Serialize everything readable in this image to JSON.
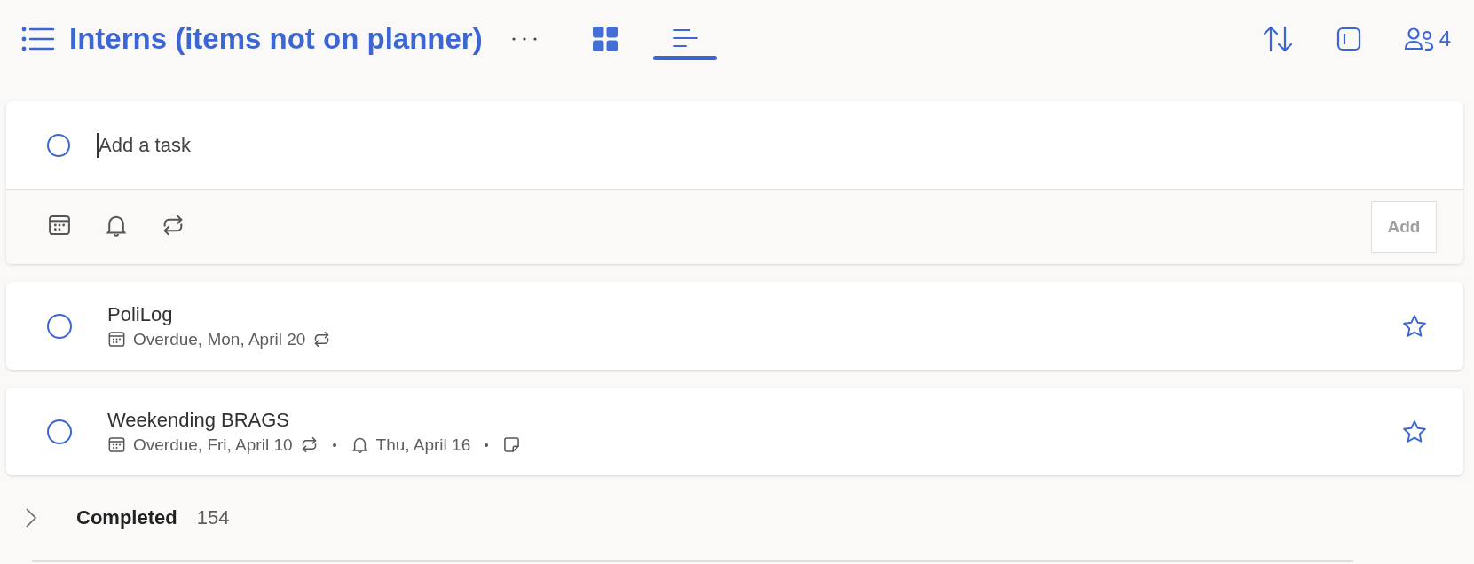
{
  "header": {
    "title": "Interns (items not on planner)",
    "views": [
      {
        "kind": "grid",
        "selected": false
      },
      {
        "kind": "list",
        "selected": true
      }
    ],
    "member_count": "4"
  },
  "add_task": {
    "placeholder": "Add a task",
    "add_button": {
      "label": "Add",
      "disabled": true
    }
  },
  "tasks": [
    {
      "title": "PoliLog",
      "completed": false,
      "starred": false,
      "meta": [
        {
          "kind": "due",
          "text": "Overdue, Mon, April 20"
        },
        {
          "kind": "repeat"
        }
      ]
    },
    {
      "title": "Weekending BRAGS",
      "completed": false,
      "starred": false,
      "meta": [
        {
          "kind": "due",
          "text": "Overdue, Fri, April 10"
        },
        {
          "kind": "repeat"
        },
        {
          "kind": "reminder",
          "text": "Thu, April 16"
        },
        {
          "kind": "note"
        }
      ]
    }
  ],
  "completed_section": {
    "label": "Completed",
    "count": "154",
    "expanded": false
  }
}
